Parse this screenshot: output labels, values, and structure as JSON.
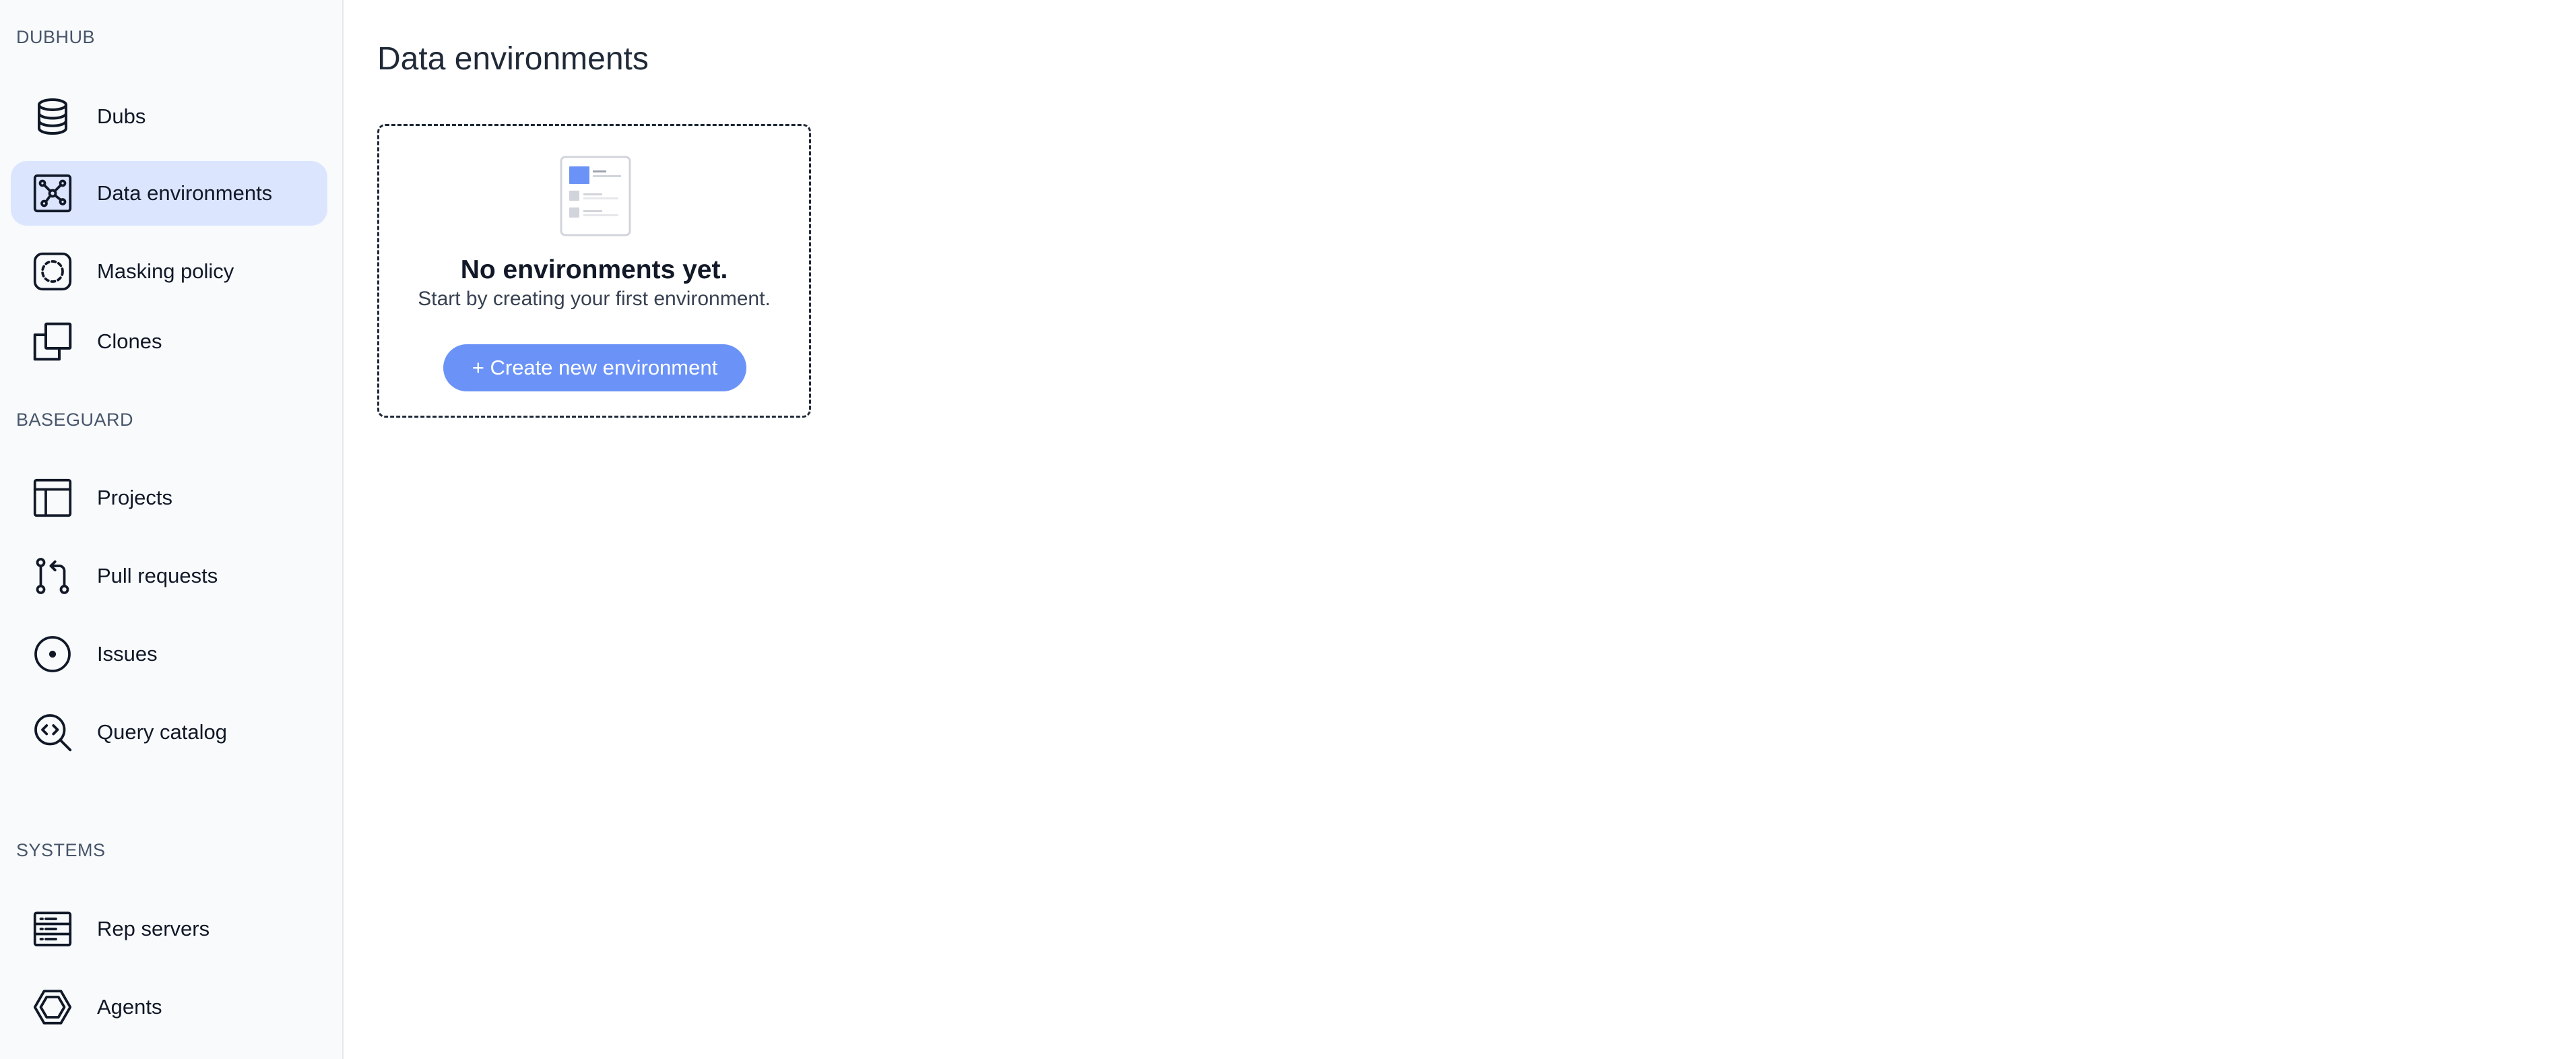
{
  "sidebar": {
    "sections": [
      {
        "label": "DUBHUB",
        "items": [
          {
            "label": "Dubs",
            "icon": "database-icon",
            "active": false
          },
          {
            "label": "Data environments",
            "icon": "network-icon",
            "active": true
          },
          {
            "label": "Masking policy",
            "icon": "masking-icon",
            "active": false
          },
          {
            "label": "Clones",
            "icon": "clone-icon",
            "active": false
          }
        ]
      },
      {
        "label": "BASEGUARD",
        "items": [
          {
            "label": "Projects",
            "icon": "layout-icon",
            "active": false
          },
          {
            "label": "Pull requests",
            "icon": "pull-request-icon",
            "active": false
          },
          {
            "label": "Issues",
            "icon": "issue-icon",
            "active": false
          },
          {
            "label": "Query catalog",
            "icon": "code-search-icon",
            "active": false
          }
        ]
      },
      {
        "label": "SYSTEMS",
        "items": [
          {
            "label": "Rep servers",
            "icon": "server-icon",
            "active": false
          },
          {
            "label": "Agents",
            "icon": "hexagon-icon",
            "active": false
          }
        ]
      }
    ]
  },
  "main": {
    "title": "Data environments",
    "empty_state": {
      "illustration": "document-placeholder-icon",
      "title": "No environments yet.",
      "subtitle": "Start by creating your first environment.",
      "button_label": "+ Create new environment"
    }
  },
  "colors": {
    "sidebar_bg": "#f8fafc",
    "active_item_bg": "#dbe6fe",
    "primary_button": "#6b93f7",
    "text_primary": "#111827"
  }
}
